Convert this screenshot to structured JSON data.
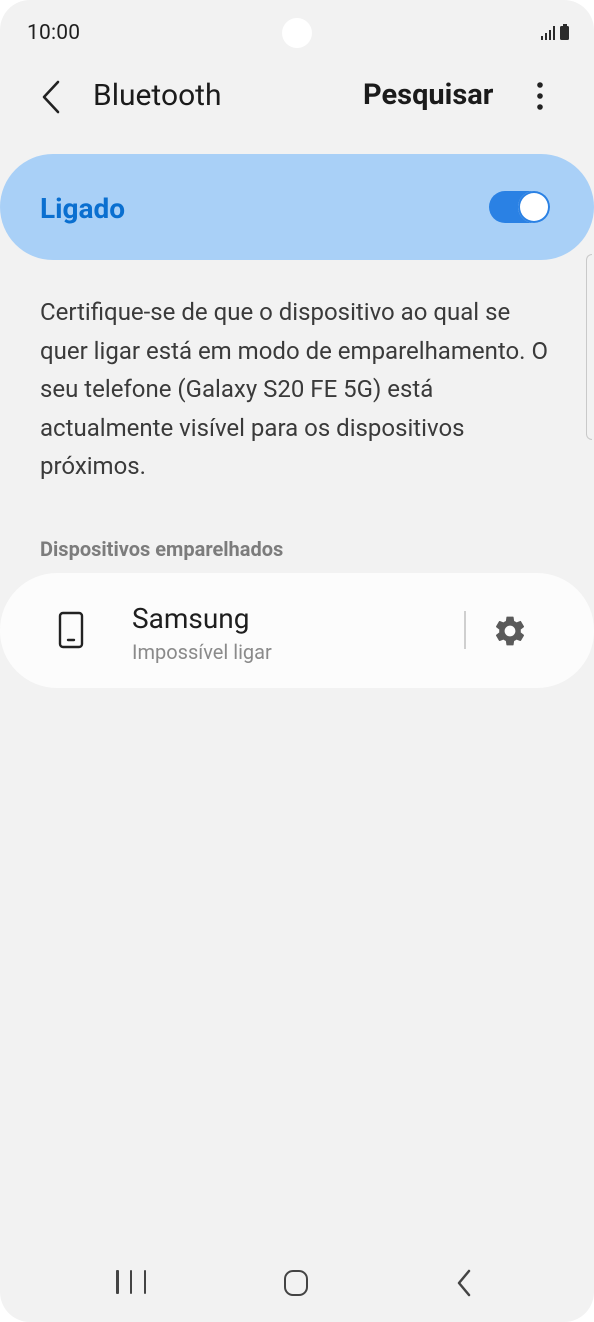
{
  "status_bar": {
    "time": "10:00"
  },
  "app_bar": {
    "title": "Bluetooth",
    "search_label": "Pesquisar",
    "back_icon": "chevron-left-icon",
    "more_icon": "more-vertical-icon"
  },
  "bluetooth_toggle": {
    "label": "Ligado",
    "state": "on"
  },
  "description": "Certifique-se de que o dispositivo ao qual se quer ligar está em modo de emparelhamento. O seu telefone (Galaxy S20 FE 5G) está actualmente visível para os dispositivos próximos.",
  "paired_devices": {
    "header": "Dispositivos emparelhados",
    "items": [
      {
        "name": "Samsung",
        "status": "Impossível ligar",
        "icon": "smartphone-icon",
        "settings_icon": "gear-icon"
      }
    ]
  },
  "colors": {
    "accent": "#0a6fd0",
    "toggle_card_bg": "#a9d0f7",
    "switch_on": "#2a81e4",
    "background": "#f2f2f2"
  }
}
